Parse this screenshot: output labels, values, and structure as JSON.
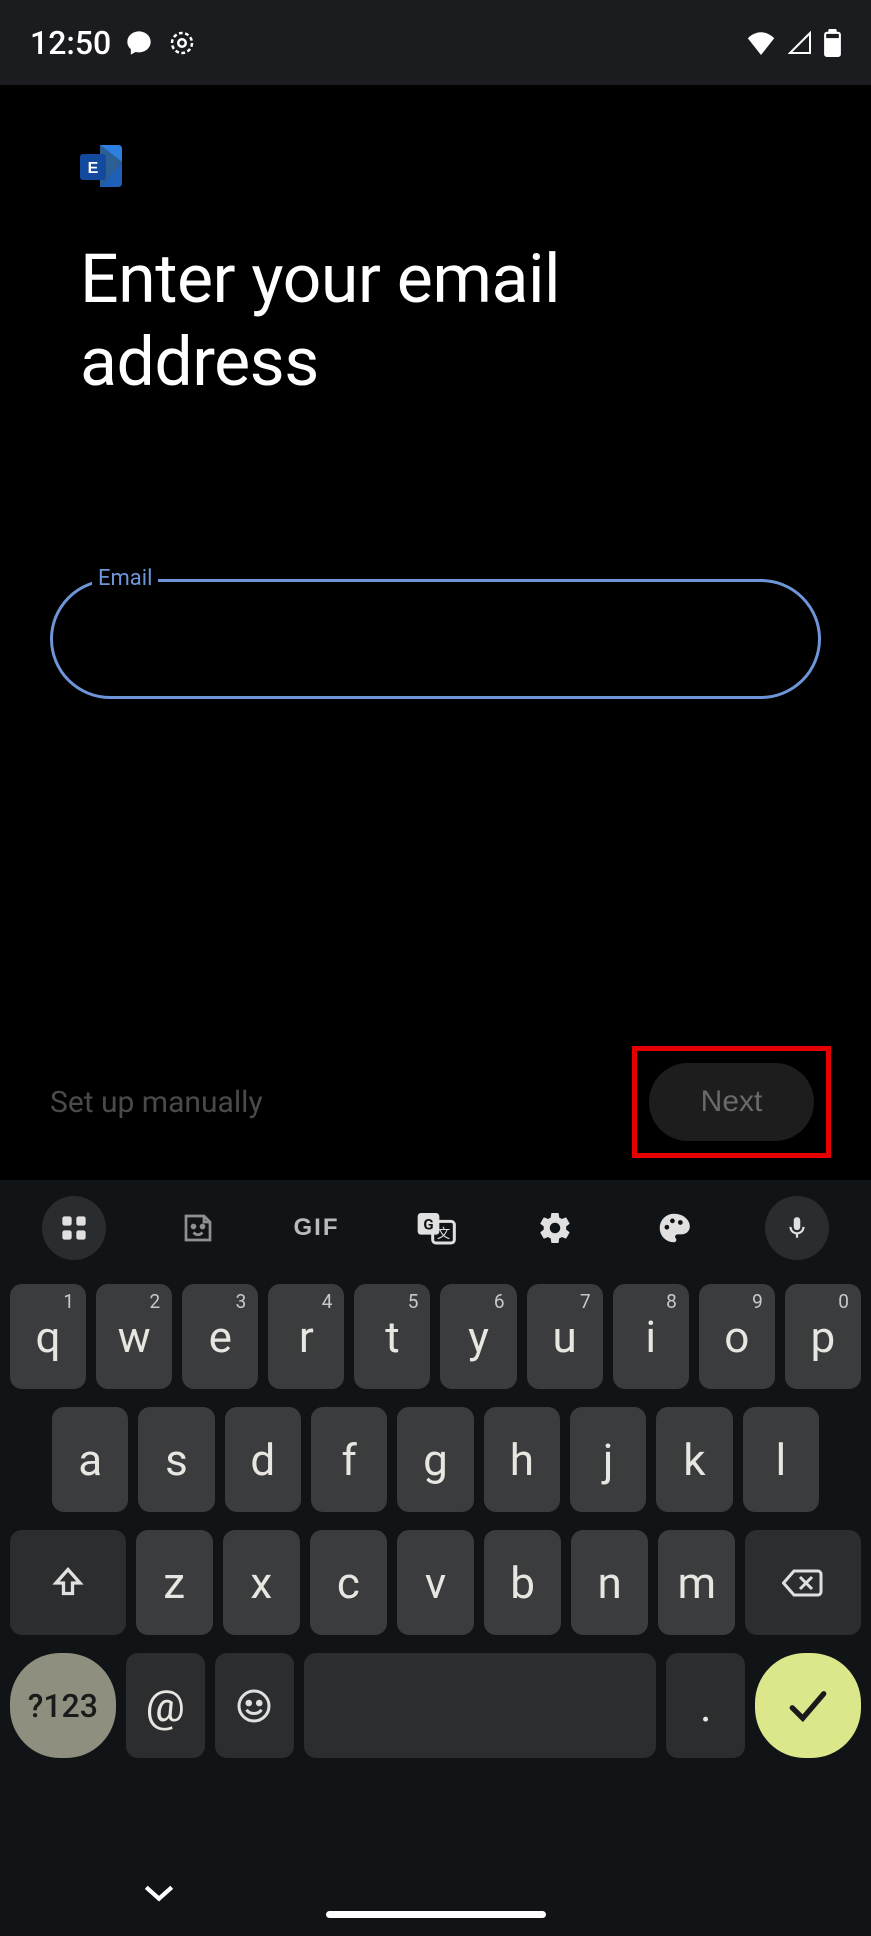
{
  "status": {
    "time": "12:50"
  },
  "page": {
    "title": "Enter your email address",
    "field_label": "Email",
    "email_value": "",
    "setup_manually": "Set up manually",
    "next": "Next"
  },
  "keyboard": {
    "toolbar_gif": "GIF",
    "row1": [
      {
        "k": "q",
        "s": "1"
      },
      {
        "k": "w",
        "s": "2"
      },
      {
        "k": "e",
        "s": "3"
      },
      {
        "k": "r",
        "s": "4"
      },
      {
        "k": "t",
        "s": "5"
      },
      {
        "k": "y",
        "s": "6"
      },
      {
        "k": "u",
        "s": "7"
      },
      {
        "k": "i",
        "s": "8"
      },
      {
        "k": "o",
        "s": "9"
      },
      {
        "k": "p",
        "s": "0"
      }
    ],
    "row2": [
      {
        "k": "a"
      },
      {
        "k": "s"
      },
      {
        "k": "d"
      },
      {
        "k": "f"
      },
      {
        "k": "g"
      },
      {
        "k": "h"
      },
      {
        "k": "j"
      },
      {
        "k": "k"
      },
      {
        "k": "l"
      }
    ],
    "row3": [
      {
        "k": "z"
      },
      {
        "k": "x"
      },
      {
        "k": "c"
      },
      {
        "k": "v"
      },
      {
        "k": "b"
      },
      {
        "k": "n"
      },
      {
        "k": "m"
      }
    ],
    "sym": "?123",
    "at": "@",
    "period": "."
  }
}
